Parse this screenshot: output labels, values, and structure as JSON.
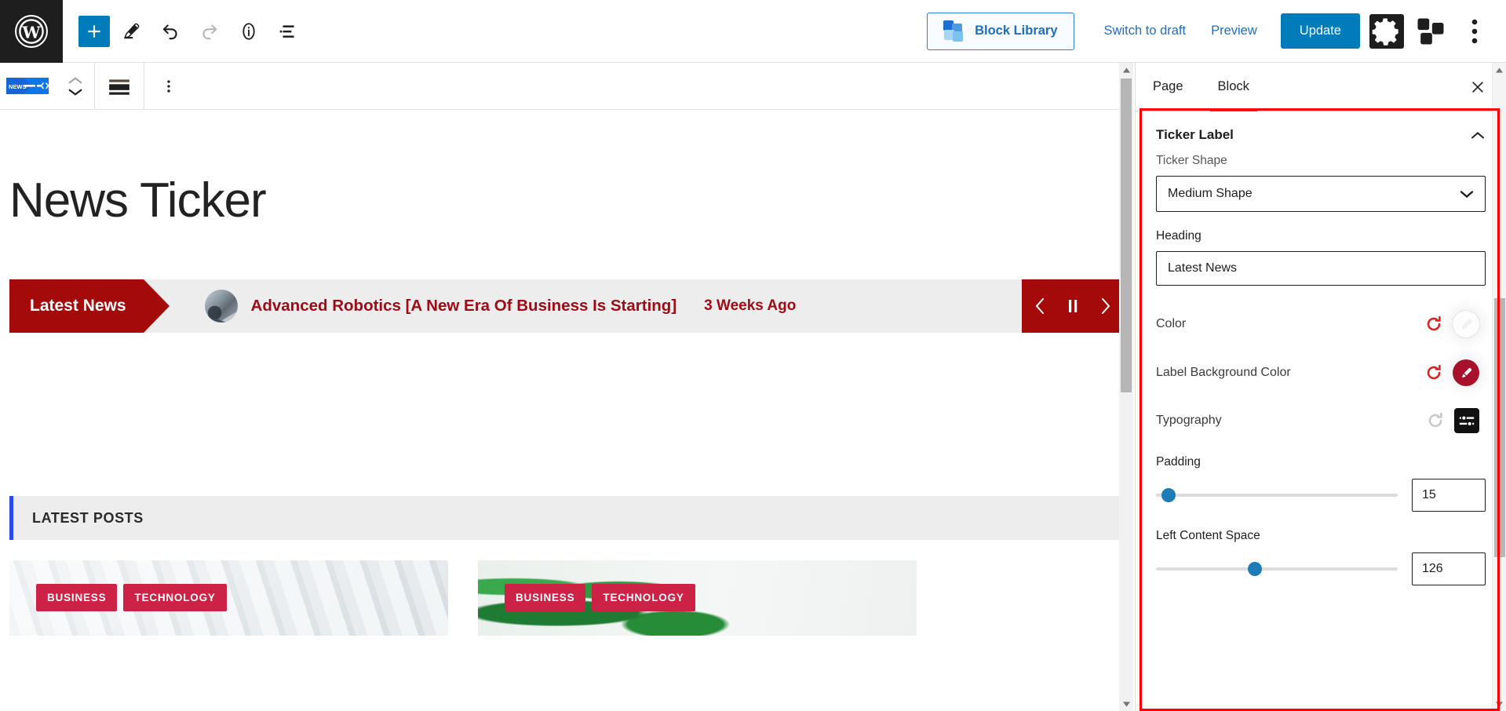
{
  "topbar": {
    "logo_icon": "wordpress-logo-icon",
    "tools": [
      {
        "name": "add-block-button",
        "icon": "plus-icon"
      },
      {
        "name": "edit-tool-button",
        "icon": "pencil-icon"
      },
      {
        "name": "undo-button",
        "icon": "undo-arrow-icon"
      },
      {
        "name": "redo-button",
        "icon": "redo-arrow-icon"
      },
      {
        "name": "details-button",
        "icon": "info-circle-icon"
      },
      {
        "name": "list-view-button",
        "icon": "list-view-icon"
      }
    ],
    "block_library_label": "Block Library",
    "switch_to_draft_label": "Switch to draft",
    "preview_label": "Preview",
    "update_label": "Update",
    "settings_icon": "gear-icon",
    "blocks_icon": "blocks-icon",
    "more_icon": "three-dots-vertical-icon"
  },
  "block_toolbar": {
    "block_type_icon": "news-ticker-block-icon",
    "move_up_icon": "chevron-up-icon",
    "move_down_icon": "chevron-down-icon",
    "align_icon": "align-wide-icon",
    "options_icon": "three-dots-vertical-icon"
  },
  "canvas": {
    "post_title": "News Ticker",
    "ticker": {
      "label": "Latest News",
      "headline": "Advanced Robotics [A New Era Of Business Is Starting]",
      "time": "3 Weeks Ago",
      "prev_icon": "chevron-left-icon",
      "pause_icon": "pause-icon",
      "next_icon": "chevron-right-icon",
      "label_bg_color": "#a50a0a",
      "text_color": "#9e0b14",
      "track_bg_color": "#ededed"
    },
    "latest_posts": {
      "heading": "LATEST POSTS",
      "accent_color": "#2b49e8",
      "cards": [
        {
          "tags": [
            "BUSINESS",
            "TECHNOLOGY"
          ]
        },
        {
          "tags": [
            "BUSINESS",
            "TECHNOLOGY"
          ]
        }
      ],
      "tag_color": "#cc2245"
    }
  },
  "sidebar": {
    "tabs": [
      {
        "label": "Page",
        "active": false
      },
      {
        "label": "Block",
        "active": true
      }
    ],
    "close_icon": "close-icon",
    "panel": {
      "title": "Ticker Label",
      "collapse_icon": "chevron-up-icon",
      "ticker_shape": {
        "label": "Ticker Shape",
        "value": "Medium Shape",
        "chevron_icon": "chevron-down-icon"
      },
      "heading": {
        "label": "Heading",
        "value": "Latest News"
      },
      "color": {
        "label": "Color",
        "reset_icon": "reset-icon",
        "swatch_icon": "paintbrush-icon",
        "swatch_color": "#fdfdfd"
      },
      "label_background_color": {
        "label": "Label Background Color",
        "reset_icon": "reset-icon",
        "swatch_icon": "paintbrush-icon",
        "swatch_color": "#a8112b"
      },
      "typography": {
        "label": "Typography",
        "reset_icon": "reset-icon",
        "settings_icon": "typography-sliders-icon"
      },
      "padding": {
        "label": "Padding",
        "value": "15",
        "percent": 4
      },
      "left_content_space": {
        "label": "Left Content Space",
        "value": "126",
        "percent": 41
      }
    }
  },
  "accent_colors": {
    "wp_blue": "#007cba",
    "link_blue": "#1d6fc4",
    "highlight_red": "#ff0000"
  }
}
